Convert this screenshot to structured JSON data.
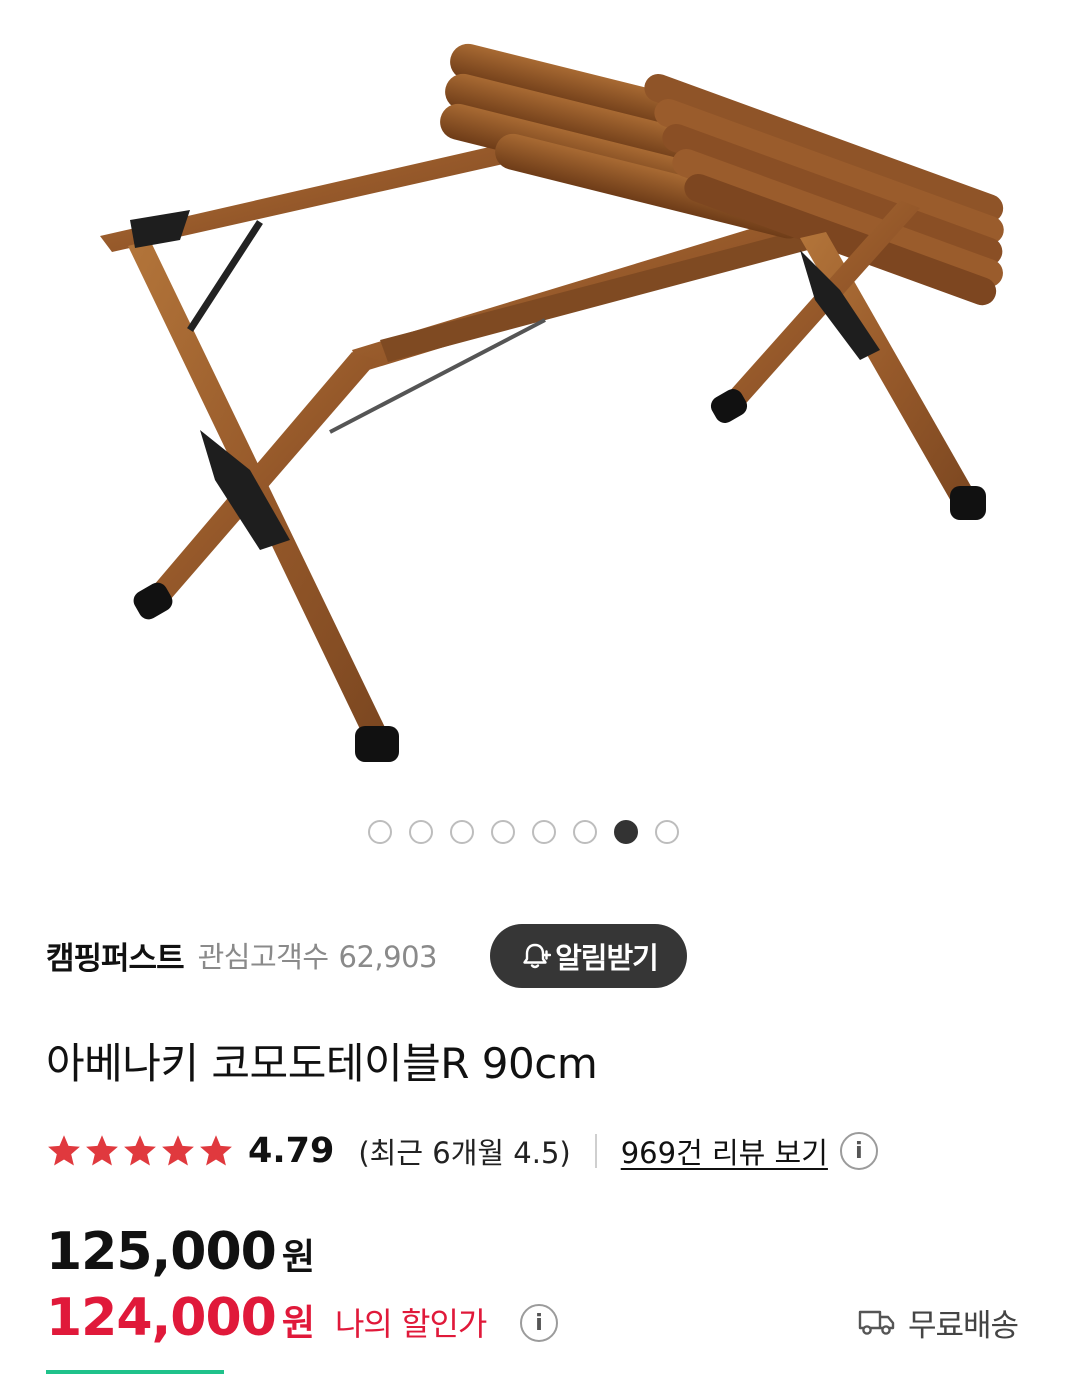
{
  "gallery": {
    "image_alt": "아베나키 코모도테이블R 90cm",
    "dot_count": 8,
    "active_index": 6
  },
  "seller": {
    "name": "캠핑퍼스트",
    "followers_label": "관심고객수",
    "followers_count": "62,903",
    "alarm_label": "알림받기"
  },
  "product": {
    "title": "아베나키 코모도테이블R 90cm"
  },
  "rating": {
    "stars": 5,
    "score": "4.79",
    "recent": "(최근 6개월 4.5)",
    "review_link": "969건 리뷰 보기",
    "star_color": "#e0393e"
  },
  "price": {
    "original": "125,000",
    "original_unit": "원",
    "sale": "124,000",
    "sale_unit": "원",
    "sale_label": "나의 할인가",
    "sale_color": "#e0193a"
  },
  "delivery": {
    "label": "무료배송",
    "icon": "truck-icon"
  }
}
